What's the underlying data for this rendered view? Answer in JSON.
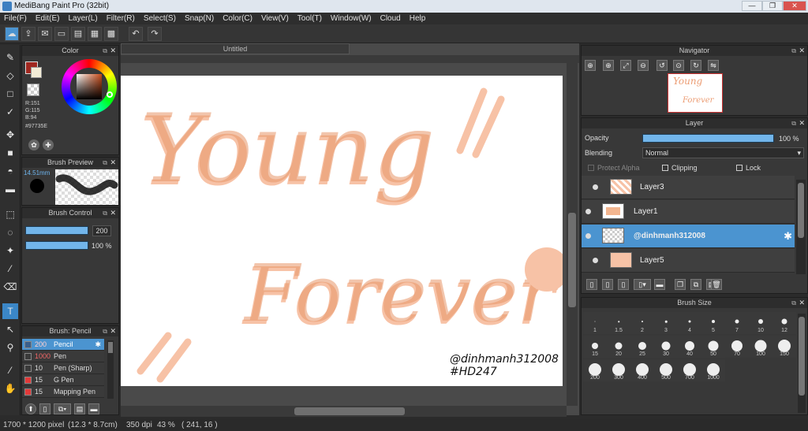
{
  "window": {
    "title": "MediBang Paint Pro (32bit)"
  },
  "menu": [
    "File(F)",
    "Edit(E)",
    "Layer(L)",
    "Filter(R)",
    "Select(S)",
    "Snap(N)",
    "Color(C)",
    "View(V)",
    "Tool(T)",
    "Window(W)",
    "Cloud",
    "Help"
  ],
  "document": {
    "tab_title": "Untitled"
  },
  "color_panel": {
    "title": "Color",
    "r": "R:151",
    "g": "G:115",
    "b": "B:94",
    "hex": "#97735E",
    "main_color": "#d37a52"
  },
  "brush_preview": {
    "title": "Brush Preview",
    "size": "14.51mm"
  },
  "brush_control": {
    "title": "Brush Control",
    "size_value": "200",
    "opacity_value": "100 %"
  },
  "brush_list": {
    "title": "Brush: Pencil",
    "items": [
      {
        "size": "200",
        "name": "Pencil",
        "color": "#3a5f8a"
      },
      {
        "size": "1000",
        "name": "Pen",
        "color": "#3a3a3a"
      },
      {
        "size": "10",
        "name": "Pen (Sharp)",
        "color": "#3a3a3a"
      },
      {
        "size": "15",
        "name": "G Pen",
        "color": "#e23a3a"
      },
      {
        "size": "15",
        "name": "Mapping Pen",
        "color": "#e23a3a"
      }
    ]
  },
  "artwork": {
    "line1": "Young",
    "line2": "Forever",
    "signature": "@dinhmanh312008",
    "hashtag": "#HD247",
    "light_color": "#f7c2a6",
    "dark_color": "#e8976a"
  },
  "navigator": {
    "title": "Navigator"
  },
  "layer_panel": {
    "title": "Layer",
    "opacity_label": "Opacity",
    "opacity_value": "100 %",
    "opacity_fraction": 1.0,
    "blending_label": "Blending",
    "blending_value": "Normal",
    "protect_alpha": "Protect Alpha",
    "clipping": "Clipping",
    "lock": "Lock",
    "layers": [
      {
        "name": "Layer3",
        "selected": false
      },
      {
        "name": "Layer1",
        "selected": false
      },
      {
        "name": "@dinhmanh312008",
        "selected": true
      },
      {
        "name": "Layer5",
        "selected": false
      }
    ]
  },
  "brush_size_panel": {
    "title": "Brush Size",
    "sizes": [
      "1",
      "1.5",
      "2",
      "3",
      "4",
      "5",
      "7",
      "10",
      "12",
      "15",
      "20",
      "25",
      "30",
      "40",
      "50",
      "70",
      "100",
      "150",
      "200",
      "300",
      "400",
      "500",
      "700",
      "1000"
    ]
  },
  "status": {
    "dimensions": "1700 * 1200 pixel",
    "physical": "(12.3 * 8.7cm)",
    "dpi": "350 dpi",
    "zoom": "43 %",
    "coords": "( 241, 16 )"
  }
}
